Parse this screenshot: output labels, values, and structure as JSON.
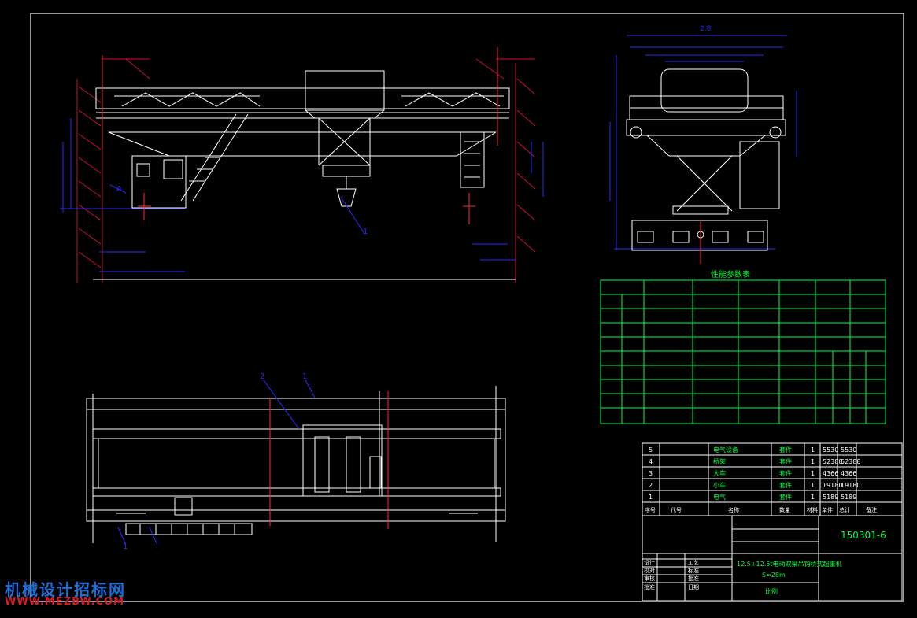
{
  "drawing": {
    "part_labels": [
      "1",
      "2",
      "1",
      "1"
    ],
    "view_top_dim": "2.8",
    "perf_table_title": "性能参数表",
    "bom_rows": [
      {
        "no": "5",
        "name": "电气设备",
        "unit": "套件",
        "qty": "1",
        "a": "5530",
        "b": "5530"
      },
      {
        "no": "4",
        "name": "桥架",
        "unit": "套件",
        "qty": "1",
        "a": "52388",
        "b": "52388"
      },
      {
        "no": "3",
        "name": "大车",
        "unit": "套件",
        "qty": "1",
        "a": "4366",
        "b": "4366"
      },
      {
        "no": "2",
        "name": "小车",
        "unit": "套件",
        "qty": "1",
        "a": "19180",
        "b": "19180"
      },
      {
        "no": "1",
        "name": "电气",
        "unit": "套件",
        "qty": "1",
        "a": "5189",
        "b": "5189"
      }
    ],
    "bom_header": [
      "序号",
      "代号",
      "名称",
      "数量",
      "材料",
      "单件",
      "总计",
      "备注"
    ],
    "drawing_number": "150301-6",
    "title_line1": "12.5+12.5t电动双梁吊钩桥式起重机",
    "title_line2": "S=28m",
    "scale_label": "比例",
    "signoff_labels": [
      "设计",
      "校对",
      "审核",
      "批准"
    ],
    "signoff_right": [
      "工艺",
      "标准",
      "批准",
      "日期"
    ]
  },
  "watermark": {
    "line1": "机械设计招标网",
    "line2": "WWW.MEZBW.COM"
  },
  "colors": {
    "background": "#000000",
    "frame": "#ffffff",
    "outline": "#ffffff",
    "dimension": "#2a2aff",
    "center_line": "#ff2a2a",
    "hatch": "#c8102e",
    "table": "#00ff40",
    "watermark_blue": "#1e6fd9",
    "watermark_red": "#d0202a"
  }
}
